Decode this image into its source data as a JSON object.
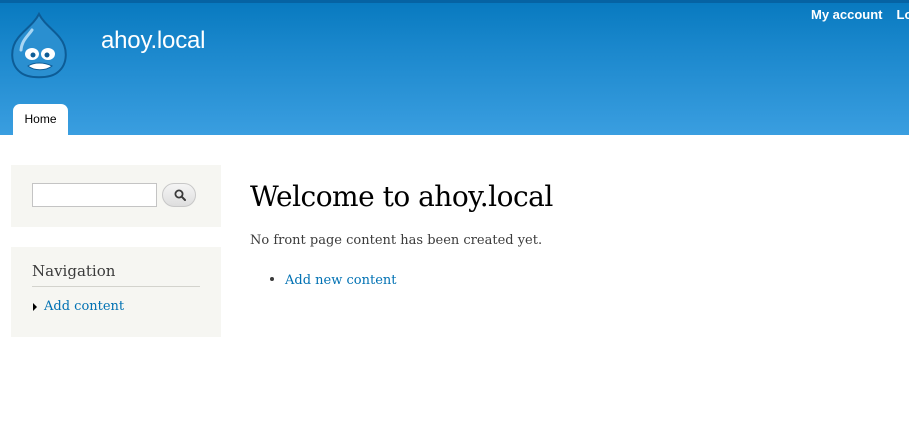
{
  "site": {
    "name": "ahoy.local"
  },
  "secondary_menu": {
    "my_account": "My account",
    "log_out": "Lo"
  },
  "main_menu": {
    "tabs": [
      {
        "label": "Home"
      }
    ]
  },
  "sidebar": {
    "search": {
      "value": "",
      "button_icon": "search-icon"
    },
    "navigation": {
      "title": "Navigation",
      "items": [
        {
          "label": "Add content"
        }
      ]
    }
  },
  "content": {
    "title": "Welcome to ahoy.local",
    "message": "No front page content has been created yet.",
    "links": [
      {
        "label": "Add new content"
      }
    ]
  },
  "colors": {
    "header_top": "#0779bf",
    "header_bottom": "#3a9ee0",
    "link": "#0071b3",
    "sidebar_bg": "#f6f6f2"
  }
}
